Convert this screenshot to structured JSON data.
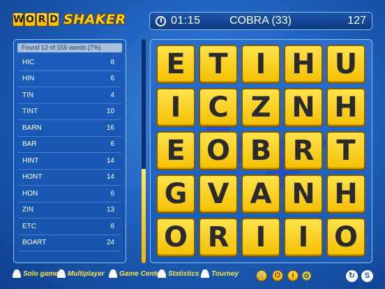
{
  "logo": {
    "tiles": [
      "W",
      "O",
      "R",
      "D"
    ],
    "text": "SHAKER"
  },
  "status": {
    "timer": "01:15",
    "current_word": "COBRA (33)",
    "score": "127"
  },
  "panel": {
    "found_text": "Found 12 of 155 words (7%)",
    "progress_fraction": 0.42,
    "words": [
      {
        "word": "HIC",
        "points": "8"
      },
      {
        "word": "HIN",
        "points": "6"
      },
      {
        "word": "TIN",
        "points": "4"
      },
      {
        "word": "TINT",
        "points": "10"
      },
      {
        "word": "BARN",
        "points": "16"
      },
      {
        "word": "BAR",
        "points": "6"
      },
      {
        "word": "HINT",
        "points": "14"
      },
      {
        "word": "HONT",
        "points": "14"
      },
      {
        "word": "HON",
        "points": "6"
      },
      {
        "word": "ZIN",
        "points": "13"
      },
      {
        "word": "ETC",
        "points": "6"
      },
      {
        "word": "BOART",
        "points": "24"
      }
    ]
  },
  "board": {
    "letters": [
      [
        "E",
        "T",
        "I",
        "H",
        "U"
      ],
      [
        "I",
        "C",
        "Z",
        "N",
        "H"
      ],
      [
        "E",
        "O",
        "B",
        "R",
        "T"
      ],
      [
        "G",
        "V",
        "A",
        "N",
        "H"
      ],
      [
        "O",
        "R",
        "I",
        "I",
        "O"
      ]
    ],
    "path": [
      [
        1,
        1
      ],
      [
        2,
        1
      ],
      [
        2,
        2
      ],
      [
        2,
        3
      ],
      [
        3,
        2
      ]
    ],
    "path_color": "#2a3fd0"
  },
  "bottom": {
    "solo": "Solo game",
    "multi": "Multiplayer",
    "gamecenter": "Game Center",
    "stats": "Statistics",
    "tourney": "Tourney",
    "power_glyph": "⏻",
    "info_glyph": "i",
    "s_glyph": "S"
  }
}
